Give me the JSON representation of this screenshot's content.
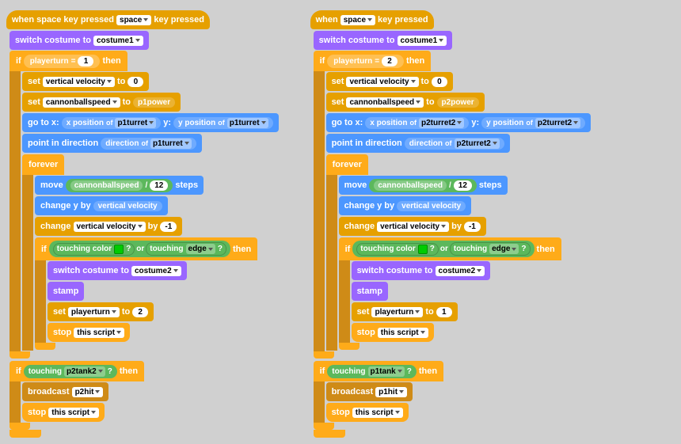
{
  "colors": {
    "hat": "#E6A000",
    "motion": "#4C97FF",
    "looks": "#9966FF",
    "control": "#FFAB19",
    "sensing": "#5CB85C",
    "sound": "#CF8B17",
    "operator": "#59C059"
  },
  "col1": {
    "hat": "when  space  key pressed",
    "hat_dropdown": "space",
    "block1": "switch costume to",
    "block1_val": "costume1",
    "if1_cond": "playerturn",
    "if1_eq": "=",
    "if1_val": "1",
    "if1_then": "then",
    "set1": "set",
    "set1_var": "vertical velocity",
    "set1_to": "to",
    "set1_val": "0",
    "set2": "set",
    "set2_var": "cannonballspeed",
    "set2_to": "to",
    "set2_val": "p1power",
    "goto": "go to x:",
    "goto_x_of": "x position",
    "goto_x_sprite": "p1turret",
    "goto_y": "y:",
    "goto_y_of": "y position",
    "goto_y_sprite": "p1turret",
    "point": "point in direction",
    "point_of": "direction",
    "point_sprite": "p1turret",
    "forever": "forever",
    "move": "move",
    "move_var": "cannonballspeed",
    "move_div": "/",
    "move_val": "12",
    "move_steps": "steps",
    "change_y": "change y by",
    "change_y_var": "vertical velocity",
    "change_vv": "change",
    "change_vv_var": "vertical velocity",
    "change_vv_by": "by",
    "change_vv_val": "-1",
    "if2": "if",
    "if2_touch": "touching color",
    "if2_or": "or",
    "if2_edge": "touching",
    "if2_edge_dd": "edge",
    "if2_then": "then",
    "switch2": "switch costume to",
    "switch2_val": "costume2",
    "stamp": "stamp",
    "set3_var": "playerturn",
    "set3_to": "to",
    "set3_val": "2",
    "stop1": "stop",
    "stop1_val": "this script",
    "if3": "if",
    "if3_touch": "touching",
    "if3_sprite": "p2tank2",
    "if3_then": "then",
    "broadcast1": "broadcast",
    "broadcast1_val": "p2hit",
    "stop2": "stop",
    "stop2_val": "this script"
  },
  "col2": {
    "hat": "when  space  key pressed",
    "hat_dropdown": "space",
    "block1": "switch costume to",
    "block1_val": "costume1",
    "if1_cond": "playerturn",
    "if1_eq": "=",
    "if1_val": "2",
    "if1_then": "then",
    "set1_var": "vertical velocity",
    "set1_val": "0",
    "set2_var": "cannonballspeed",
    "set2_val": "p2power",
    "goto_x_of": "x position",
    "goto_x_sprite": "p2turret2",
    "goto_y_of": "y position",
    "goto_y_sprite": "p2turret2",
    "point_of": "direction",
    "point_sprite": "p2turret2",
    "forever": "forever",
    "move_var": "cannonballspeed",
    "move_val": "12",
    "move_steps": "steps",
    "change_y_var": "vertical velocity",
    "change_vv_var": "vertical velocity",
    "change_vv_val": "-1",
    "if2_touch": "touching color",
    "if2_edge_dd": "edge",
    "switch2_val": "costume2",
    "set3_var": "playerturn",
    "set3_val": "1",
    "stop1_val": "this script",
    "if3_sprite": "p1tank",
    "broadcast1_val": "p1hit",
    "stop2_val": "this script"
  }
}
